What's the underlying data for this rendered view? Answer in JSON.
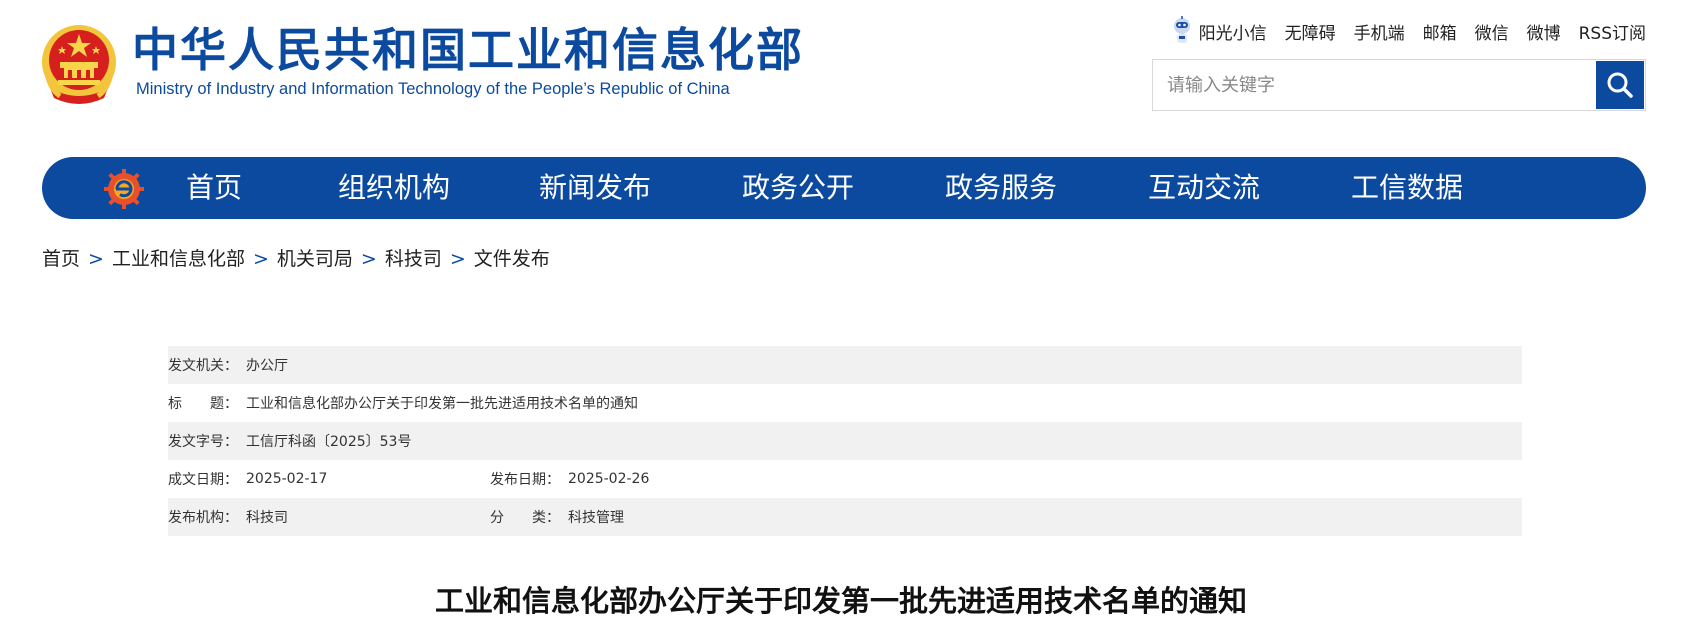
{
  "header": {
    "logo_cn": "中华人民共和国工业和信息化部",
    "logo_en": "Ministry of Industry and Information Technology of the People’s Republic of China"
  },
  "toplinks": [
    "阳光小信",
    "无障碍",
    "手机端",
    "邮箱",
    "微信",
    "微博",
    "RSS订阅"
  ],
  "search": {
    "placeholder": "请输入关键字"
  },
  "nav": {
    "items": [
      "首页",
      "组织机构",
      "新闻发布",
      "政务公开",
      "政务服务",
      "互动交流",
      "工信数据"
    ]
  },
  "breadcrumb": [
    "首页",
    "工业和信息化部",
    "机关司局",
    "科技司",
    "文件发布"
  ],
  "info": {
    "issuer_label": "发文机关：",
    "issuer": "办公厅",
    "title_label": "标　　题：",
    "title": "工业和信息化部办公厅关于印发第一批先进适用技术名单的通知",
    "docno_label": "发文字号：",
    "docno": "工信厅科函〔2025〕53号",
    "created_label": "成文日期：",
    "created": "2025-02-17",
    "published_label": "发布日期：",
    "published": "2025-02-26",
    "org_label": "发布机构：",
    "org": "科技司",
    "category_label": "分　　类：",
    "category": "科技管理"
  },
  "article": {
    "title": "工业和信息化部办公厅关于印发第一批先进适用技术名单的通知"
  },
  "colors": {
    "brand": "#0b4a9e",
    "shade": "#f1f1f1"
  }
}
